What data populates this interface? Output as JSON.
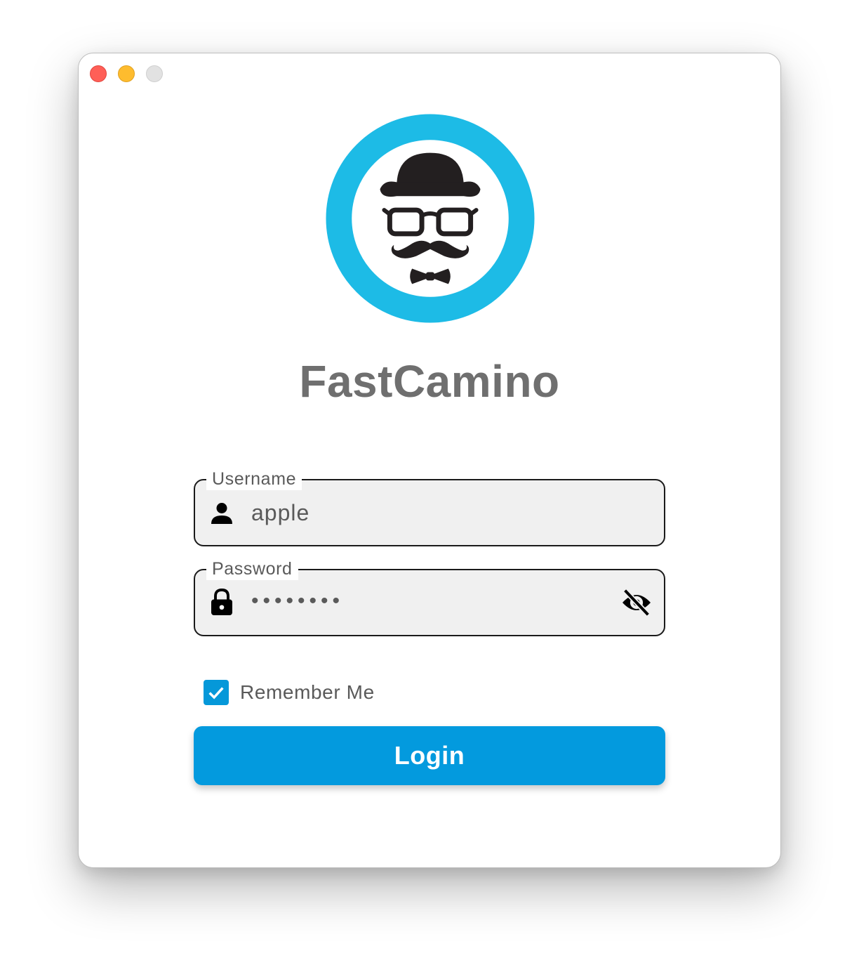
{
  "window": {
    "controls": [
      "close-button",
      "minimize-button",
      "maximize-button"
    ]
  },
  "app": {
    "logo": "fastcamino-logo-gentleman-hat-glasses-mustache",
    "title": "FastCamino",
    "accent_color": "#1dbbe6"
  },
  "form": {
    "username": {
      "label": "Username",
      "value": "apple",
      "icon": "person-icon"
    },
    "password": {
      "label": "Password",
      "value": "••••••••",
      "icon": "lock-icon",
      "toggle_icon": "eye-off-icon"
    },
    "remember": {
      "label": "Remember Me",
      "checked": true
    },
    "login_label": "Login",
    "button_color": "#039ade"
  }
}
